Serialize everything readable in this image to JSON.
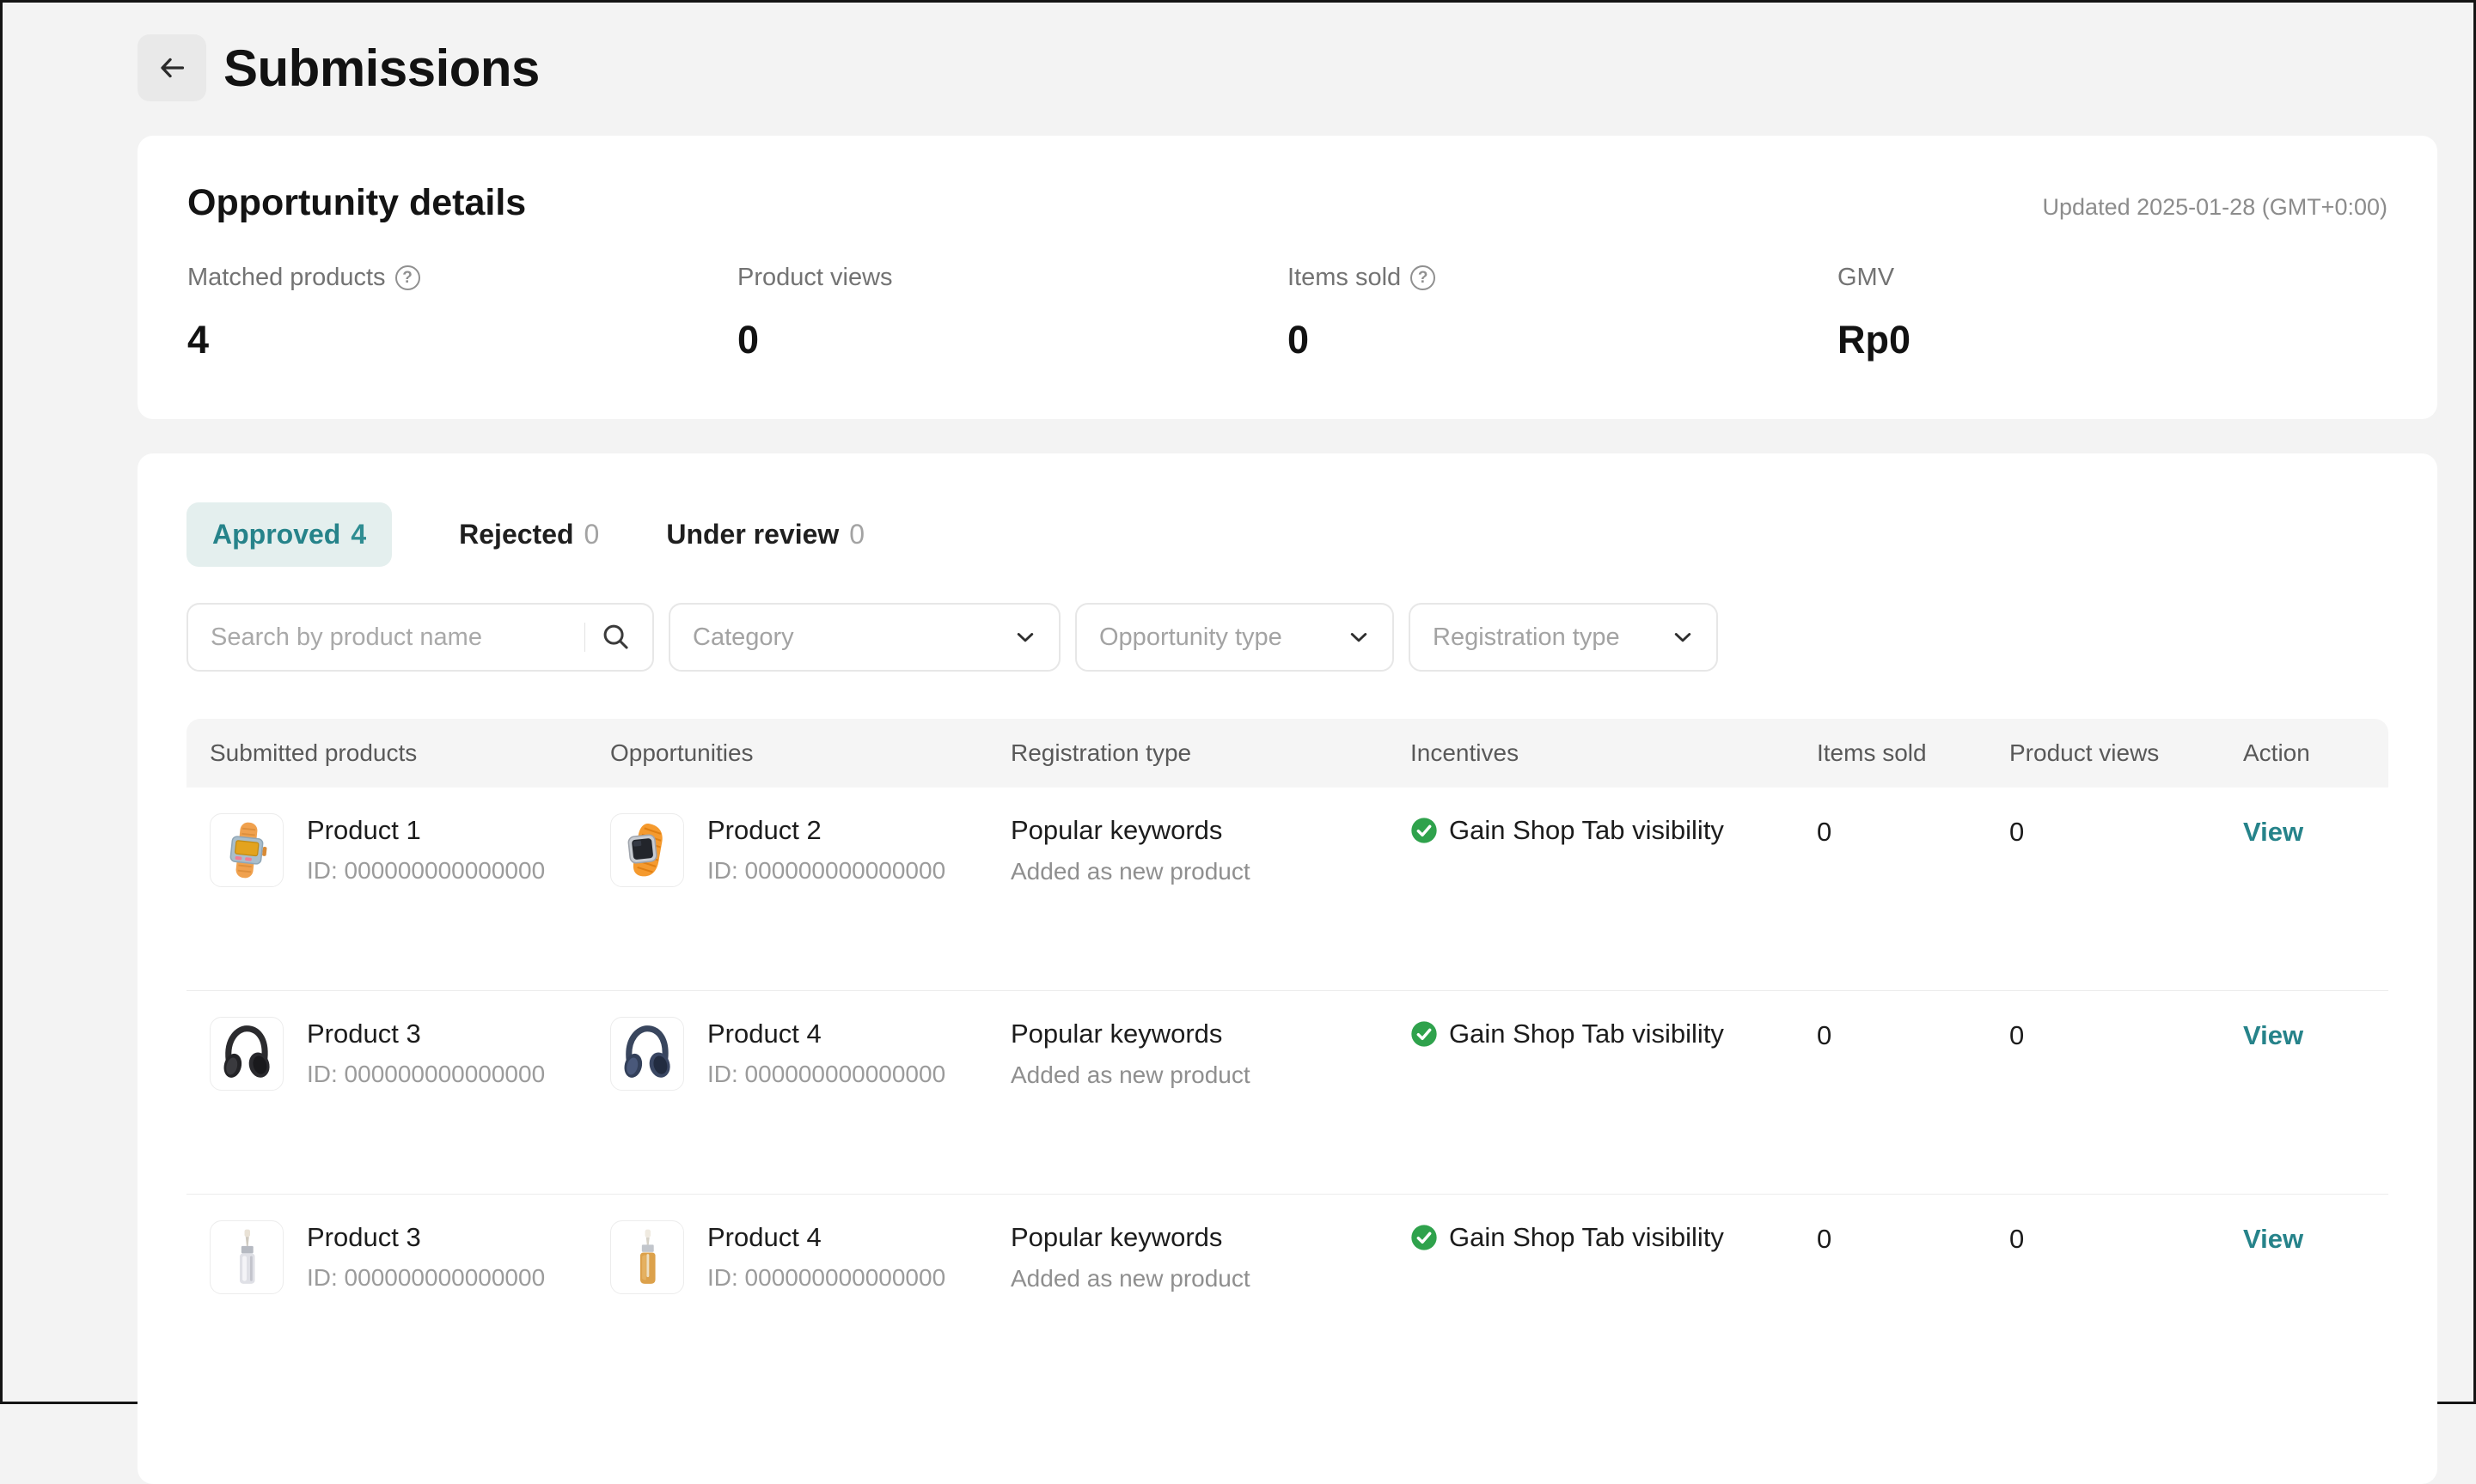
{
  "page": {
    "title": "Submissions",
    "back_icon": "arrow-left"
  },
  "opportunity": {
    "title": "Opportunity details",
    "updated": "Updated 2025-01-28 (GMT+0:00)",
    "stats": [
      {
        "label": "Matched products",
        "value": "4",
        "has_help": true
      },
      {
        "label": "Product views",
        "value": "0",
        "has_help": false
      },
      {
        "label": "Items sold",
        "value": "0",
        "has_help": true
      },
      {
        "label": "GMV",
        "value": "Rp0",
        "has_help": false
      }
    ]
  },
  "tabs": [
    {
      "label": "Approved",
      "count": "4",
      "active": true
    },
    {
      "label": "Rejected",
      "count": "0",
      "active": false
    },
    {
      "label": "Under review",
      "count": "0",
      "active": false
    }
  ],
  "filters": {
    "search_placeholder": "Search by product name",
    "search_icon": "search",
    "dropdowns": [
      {
        "label": "Category",
        "icon": "chevron-down"
      },
      {
        "label": "Opportunity type",
        "icon": "chevron-down"
      },
      {
        "label": "Registration type",
        "icon": "chevron-down"
      }
    ]
  },
  "table": {
    "columns": [
      "Submitted products",
      "Opportunities",
      "Registration type",
      "Incentives",
      "Items sold",
      "Product views",
      "Action"
    ],
    "rows": [
      {
        "submitted": {
          "name": "Product 1",
          "id": "ID: 000000000000000",
          "thumb": "watch-digital-orange"
        },
        "opportunity": {
          "name": "Product 2",
          "id": "ID: 000000000000000",
          "thumb": "watch-smart-orange"
        },
        "registration": {
          "type": "Popular keywords",
          "sub": "Added as new product"
        },
        "incentive": {
          "label": "Gain Shop Tab visibility",
          "status_icon": "check-circle-green"
        },
        "items_sold": "0",
        "product_views": "0",
        "action": "View"
      },
      {
        "submitted": {
          "name": "Product 3",
          "id": "ID: 000000000000000",
          "thumb": "headphones-black"
        },
        "opportunity": {
          "name": "Product 4",
          "id": "ID: 000000000000000",
          "thumb": "headphones-navy"
        },
        "registration": {
          "type": "Popular keywords",
          "sub": "Added as new product"
        },
        "incentive": {
          "label": "Gain Shop Tab visibility",
          "status_icon": "check-circle-green"
        },
        "items_sold": "0",
        "product_views": "0",
        "action": "View"
      },
      {
        "submitted": {
          "name": "Product 3",
          "id": "ID: 000000000000000",
          "thumb": "dropper-bottle-silver"
        },
        "opportunity": {
          "name": "Product 4",
          "id": "ID: 000000000000000",
          "thumb": "dropper-bottle-amber"
        },
        "registration": {
          "type": "Popular keywords",
          "sub": "Added as new product"
        },
        "incentive": {
          "label": "Gain Shop Tab visibility",
          "status_icon": "check-circle-green"
        },
        "items_sold": "0",
        "product_views": "0",
        "action": "View"
      }
    ]
  },
  "colors": {
    "accent_teal": "#26838A",
    "accent_teal_bg": "#E4EFEE",
    "success_green": "#2FA24C",
    "page_bg": "#F3F3F3",
    "card_bg": "#FFFFFF",
    "table_header_bg": "#F5F5F5"
  }
}
